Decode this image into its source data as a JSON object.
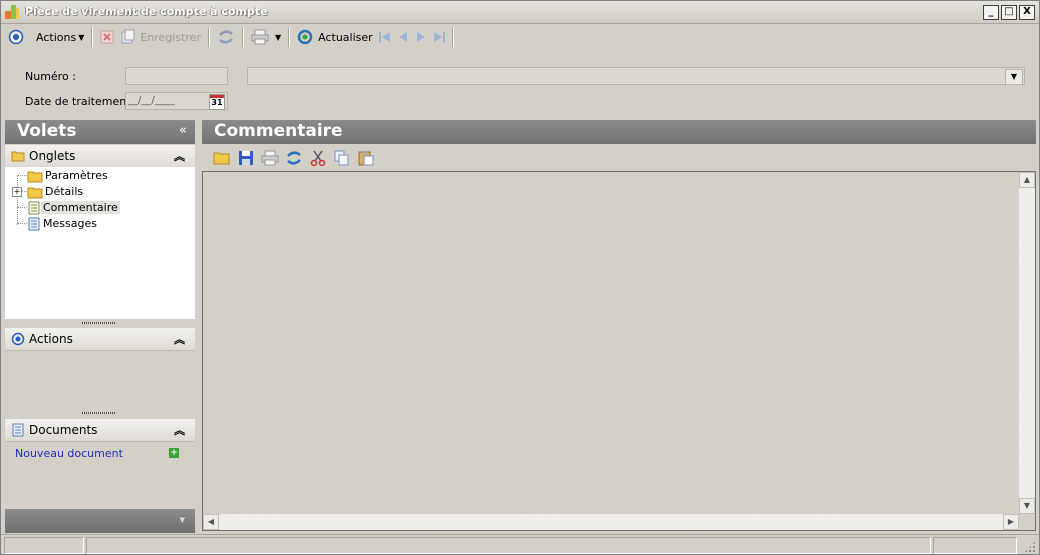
{
  "window": {
    "title": "Pièce de virement de compte à compte",
    "minimize_glyph": "_",
    "maximize_glyph": "□",
    "close_glyph": "X"
  },
  "toolbar": {
    "actions_label": "Actions",
    "save_label": "Enregistrer",
    "refresh_label": "Actualiser"
  },
  "form": {
    "numero_label": "Numéro :",
    "numero_value": "",
    "date_label": "Date de traitement :",
    "date_value": "__/__/____",
    "calendar_day": "31",
    "combo_value": ""
  },
  "left_panel": {
    "title": "Volets",
    "collapse_glyph": "«",
    "sections": {
      "onglets": {
        "title": "Onglets",
        "tree": [
          {
            "label": "Paramètres",
            "icon": "folder-icon"
          },
          {
            "label": "Détails",
            "icon": "folder-icon",
            "expander": "+"
          },
          {
            "label": "Commentaire",
            "icon": "document-icon"
          },
          {
            "label": "Messages",
            "icon": "document-icon"
          }
        ]
      },
      "actions": {
        "title": "Actions"
      },
      "documents": {
        "title": "Documents",
        "new_document_link": "Nouveau document"
      }
    }
  },
  "right_panel": {
    "title": "Commentaire",
    "toolbar_icons": [
      "open-folder-icon",
      "save-icon",
      "print-icon",
      "refresh-icon",
      "cut-icon",
      "copy-icon",
      "paste-icon"
    ]
  },
  "colors": {
    "panel_header": "#7f7f7f",
    "window_bg": "#d4d0c8",
    "link": "#1f2bbf"
  }
}
